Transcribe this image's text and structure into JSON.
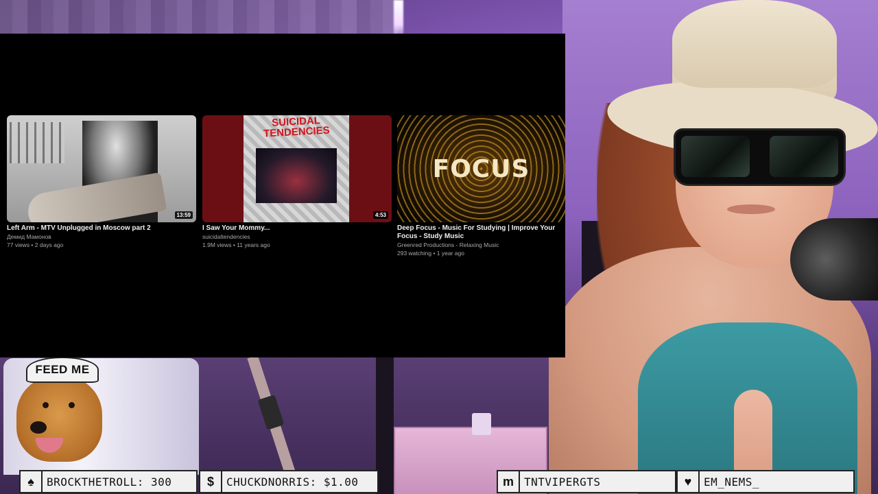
{
  "overlay_text": {
    "dog_hat": "FEED ME"
  },
  "videos": [
    {
      "title": "Left Arm - MTV Unplugged in Moscow part 2",
      "channel": "Демид Мамонов",
      "meta": "77 views • 2 days ago",
      "duration": "13:59"
    },
    {
      "title": "I Saw Your Mommy...",
      "channel": "suicidaltendencies",
      "meta": "1.9M views • 11 years ago",
      "duration": "4:53",
      "thumbnail_text": "SUICIDAL TENDENCIES"
    },
    {
      "title": "Deep Focus - Music For Studying | Improve Your Focus - Study Music",
      "channel": "Greenred Productions - Relaxing Music",
      "meta": "293 watching • 1 year ago",
      "thumbnail_text": "FOCUS"
    }
  ],
  "ticker": [
    {
      "icon": "spade-icon",
      "glyph": "♠",
      "text": "BROCKTHETROLL: 300"
    },
    {
      "icon": "dollar-icon",
      "glyph": "$",
      "text": "CHUCKDNORRIS: $1.00"
    },
    {
      "icon": "m-icon",
      "glyph": "m",
      "text": "TNTVIPERGTS"
    },
    {
      "icon": "heart-icon",
      "glyph": "♥",
      "text": "EM_NEMS_"
    }
  ],
  "colors": {
    "panel_bg": "#000000",
    "title_text": "#f1f1f1",
    "meta_text": "#aaaaaa",
    "ticker_bg": "#f0f0f0"
  }
}
